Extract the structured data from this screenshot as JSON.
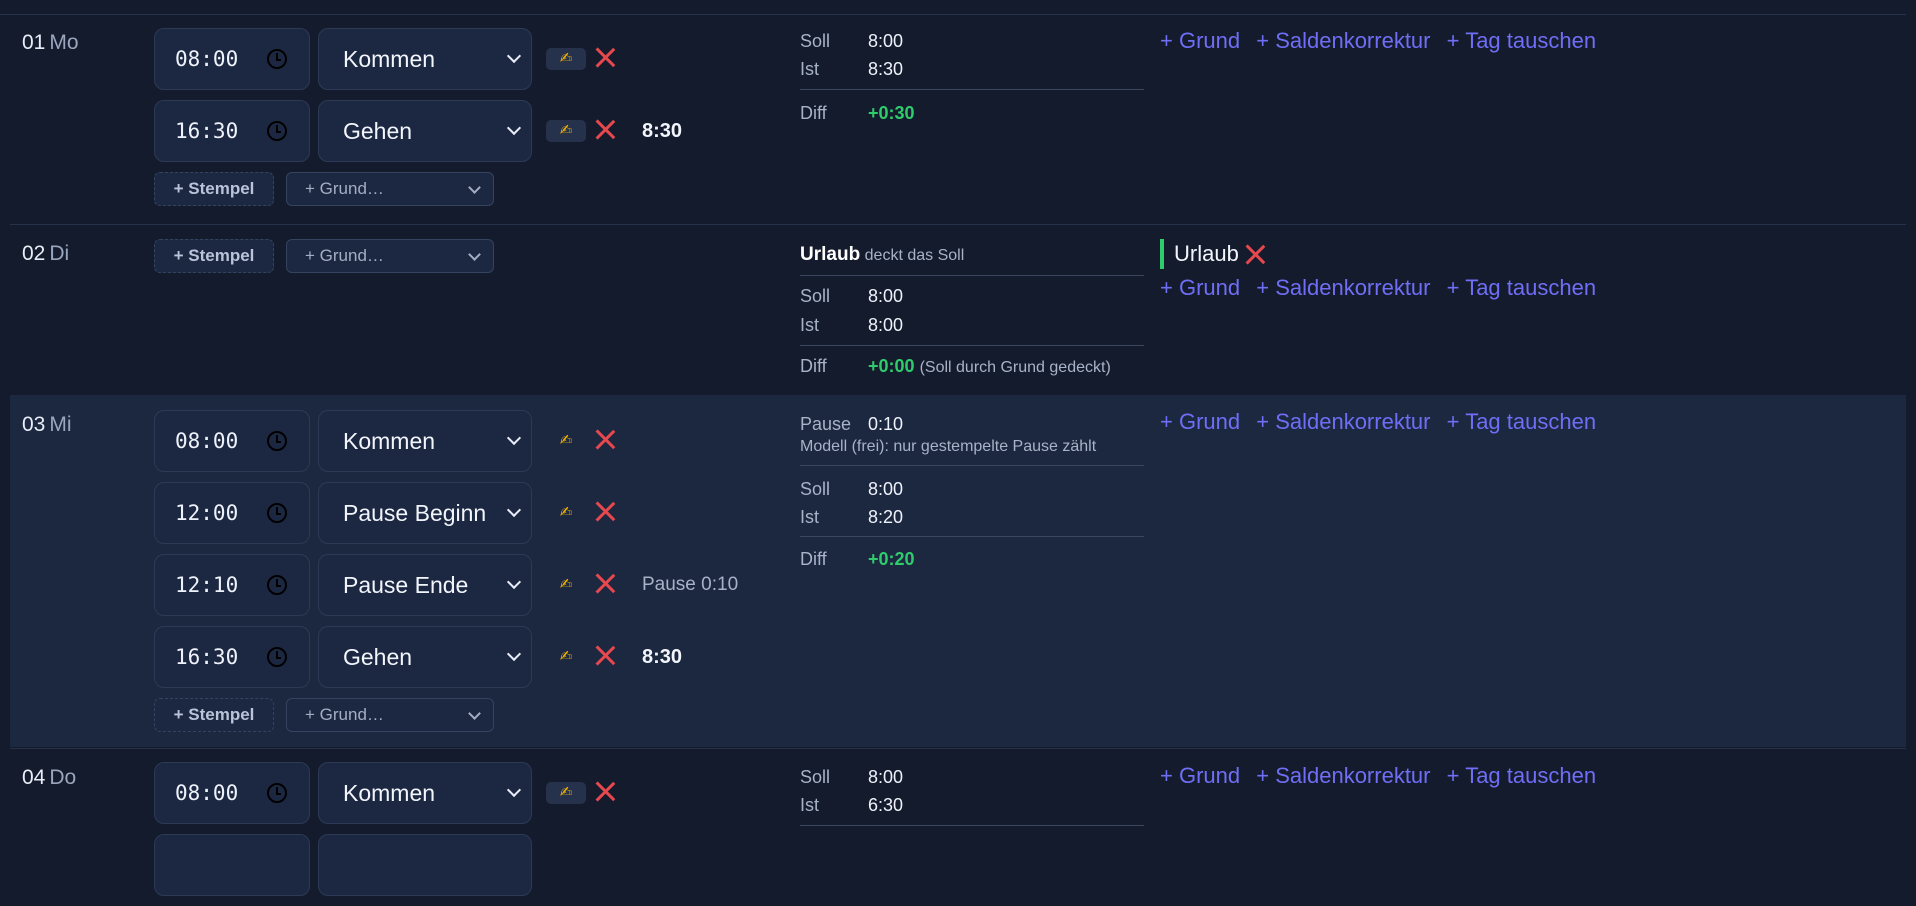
{
  "days": [
    {
      "date": "01",
      "weekday": "Mo",
      "stamps": [
        {
          "time": "08:00",
          "type": "Kommen",
          "edit_icon": "✍"
        },
        {
          "time": "16:30",
          "type": "Gehen",
          "edit_icon": "✍",
          "total": "8:30"
        }
      ],
      "add_stamp": "+ Stempel",
      "add_grund": "+ Grund…",
      "summary": {
        "soll_label": "Soll",
        "soll": "8:00",
        "ist_label": "Ist",
        "ist": "8:30",
        "diff_label": "Diff",
        "diff": "+0:30"
      },
      "actions": [
        "+ Grund",
        "+ Saldenkorrektur",
        "+ Tag tauschen"
      ]
    },
    {
      "date": "02",
      "weekday": "Di",
      "add_stamp": "+ Stempel",
      "add_grund": "+ Grund…",
      "summary": {
        "reason_title": "Urlaub",
        "reason_text": "deckt das Soll",
        "soll_label": "Soll",
        "soll": "8:00",
        "ist_label": "Ist",
        "ist": "8:00",
        "diff_label": "Diff",
        "diff": "+0:00",
        "diff_note": "(Soll durch Grund gedeckt)"
      },
      "reason": "Urlaub",
      "actions": [
        "+ Grund",
        "+ Saldenkorrektur",
        "+ Tag tauschen"
      ]
    },
    {
      "date": "03",
      "weekday": "Mi",
      "stamps": [
        {
          "time": "08:00",
          "type": "Kommen",
          "edit_icon": "✍"
        },
        {
          "time": "12:00",
          "type": "Pause Beginn",
          "edit_icon": "✍"
        },
        {
          "time": "12:10",
          "type": "Pause Ende",
          "edit_icon": "✍",
          "pause": "Pause 0:10"
        },
        {
          "time": "16:30",
          "type": "Gehen",
          "edit_icon": "✍",
          "total": "8:30"
        }
      ],
      "add_stamp": "+ Stempel",
      "add_grund": "+ Grund…",
      "summary": {
        "pause_label": "Pause",
        "pause": "0:10",
        "pause_note": "Modell (frei): nur gestempelte Pause zählt",
        "soll_label": "Soll",
        "soll": "8:00",
        "ist_label": "Ist",
        "ist": "8:20",
        "diff_label": "Diff",
        "diff": "+0:20"
      },
      "actions": [
        "+ Grund",
        "+ Saldenkorrektur",
        "+ Tag tauschen"
      ]
    },
    {
      "date": "04",
      "weekday": "Do",
      "stamps": [
        {
          "time": "08:00",
          "type": "Kommen",
          "edit_icon": "✍"
        }
      ],
      "summary": {
        "soll_label": "Soll",
        "soll": "8:00",
        "ist_label": "Ist",
        "ist": "6:30"
      },
      "actions": [
        "+ Grund",
        "+ Saldenkorrektur",
        "+ Tag tauschen"
      ]
    }
  ],
  "colors": {
    "background": "#141b2d",
    "accent_link": "#6f6ef5",
    "positive_diff": "#2ecc6b",
    "delete": "#e5484d",
    "highlight_row": "#1c2740"
  }
}
